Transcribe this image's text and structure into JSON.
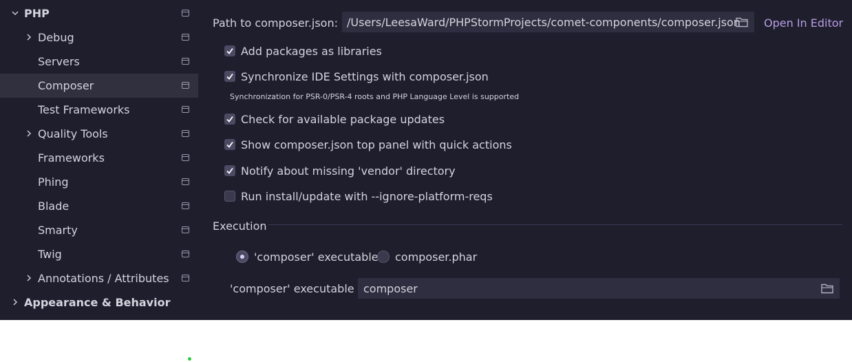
{
  "sidebar": {
    "items": [
      {
        "label": "PHP",
        "chevron": "down",
        "bold": true,
        "page_icon": true
      },
      {
        "label": "Debug",
        "chevron": "right",
        "page_icon": true
      },
      {
        "label": "Servers",
        "chevron": "",
        "page_icon": true
      },
      {
        "label": "Composer",
        "chevron": "",
        "page_icon": true,
        "selected": true
      },
      {
        "label": "Test Frameworks",
        "chevron": "",
        "page_icon": true
      },
      {
        "label": "Quality Tools",
        "chevron": "right",
        "page_icon": true
      },
      {
        "label": "Frameworks",
        "chevron": "",
        "page_icon": true
      },
      {
        "label": "Phing",
        "chevron": "",
        "page_icon": true
      },
      {
        "label": "Blade",
        "chevron": "",
        "page_icon": true
      },
      {
        "label": "Smarty",
        "chevron": "",
        "page_icon": true
      },
      {
        "label": "Twig",
        "chevron": "",
        "page_icon": true
      },
      {
        "label": "Annotations / Attributes",
        "chevron": "right",
        "page_icon": true
      },
      {
        "label": "Appearance & Behavior",
        "chevron": "right",
        "bold": true,
        "page_icon": false
      }
    ]
  },
  "composer": {
    "path_label": "Path to composer.json:",
    "path_value": "/Users/LeesaWard/PHPStormProjects/comet-components/composer.json",
    "open_in_editor": "Open In Editor",
    "options": [
      {
        "label": "Add packages as libraries",
        "checked": true
      },
      {
        "label": "Synchronize IDE Settings with composer.json",
        "checked": true
      },
      {
        "label": "Check for available package updates",
        "checked": true
      },
      {
        "label": "Show composer.json top panel with quick actions",
        "checked": true
      },
      {
        "label": "Notify about missing 'vendor' directory",
        "checked": true
      },
      {
        "label": "Run install/update with --ignore-platform-reqs",
        "checked": false
      }
    ],
    "sync_note": "Synchronization for PSR-0/PSR-4 roots and PHP Language Level is supported"
  },
  "execution": {
    "section_title": "Execution",
    "radio_executable": "'composer' executable",
    "radio_phar": "composer.phar",
    "selected": "executable",
    "field_label": "'composer' executable",
    "field_value": "composer"
  },
  "colors": {
    "background": "#1f1e2d",
    "selected_row": "#30303f",
    "field": "#2f2e40",
    "link": "#b79ee3",
    "indicator_dot": "#2ecc40"
  }
}
